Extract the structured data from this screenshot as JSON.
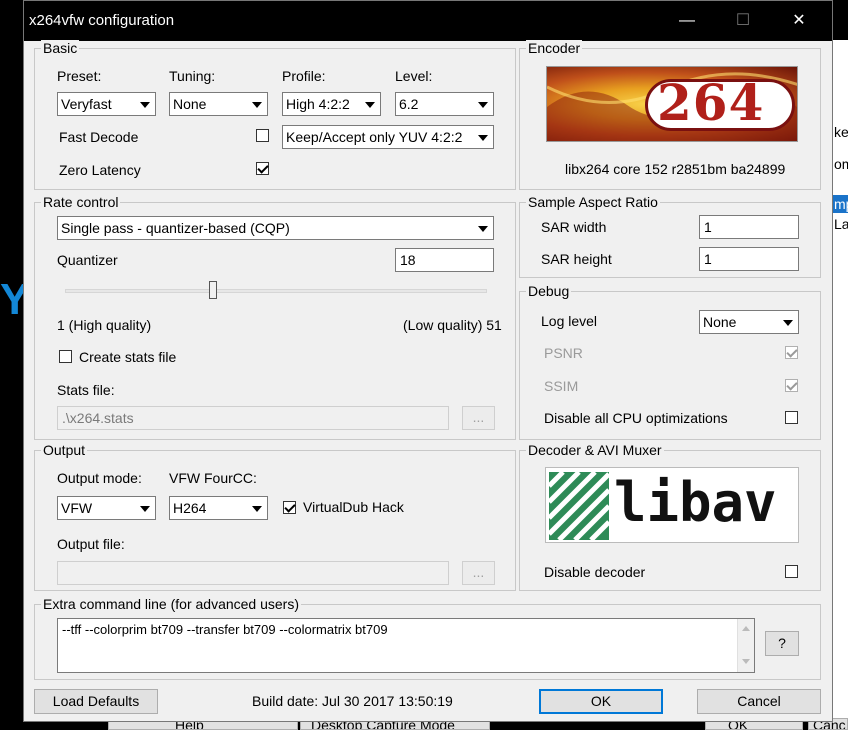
{
  "window": {
    "title": "x264vfw configuration",
    "controls": [
      "—",
      "☐",
      "✕"
    ]
  },
  "background_app": {
    "right_texts": [
      "key",
      "om",
      "mp",
      "La"
    ],
    "left_logo": "Y",
    "bottom_buttons": [
      "Help",
      "Desktop Capture Mode",
      "OK",
      "Canc"
    ]
  },
  "basic": {
    "title": "Basic",
    "preset_label": "Preset:",
    "preset_value": "Veryfast",
    "tuning_label": "Tuning:",
    "tuning_value": "None",
    "profile_label": "Profile:",
    "profile_value": "High 4:2:2",
    "level_label": "Level:",
    "level_value": "6.2",
    "fast_decode_label": "Fast Decode",
    "zero_latency_label": "Zero Latency",
    "colorspace_value": "Keep/Accept only YUV 4:2:2"
  },
  "encoder": {
    "title": "Encoder",
    "logo_text": "264",
    "version": "libx264 core 152 r2851bm ba24899"
  },
  "rate_control": {
    "title": "Rate control",
    "mode_value": "Single pass - quantizer-based (CQP)",
    "quantizer_label": "Quantizer",
    "quantizer_value": "18",
    "slider_fraction": 0.35,
    "high_label": "1 (High quality)",
    "low_label": "(Low quality) 51",
    "create_stats_label": "Create stats file",
    "stats_file_label": "Stats file:",
    "stats_file_value": ".\\x264.stats",
    "browse_label": "..."
  },
  "sar": {
    "title": "Sample Aspect Ratio",
    "width_label": "SAR width",
    "width_value": "1",
    "height_label": "SAR height",
    "height_value": "1"
  },
  "debug": {
    "title": "Debug",
    "log_level_label": "Log level",
    "log_level_value": "None",
    "psnr_label": "PSNR",
    "ssim_label": "SSIM",
    "disable_cpu_label": "Disable all CPU optimizations"
  },
  "output": {
    "title": "Output",
    "mode_label": "Output mode:",
    "mode_value": "VFW",
    "fourcc_label": "VFW FourCC:",
    "fourcc_value": "H264",
    "vdub_label": "VirtualDub Hack",
    "file_label": "Output file:",
    "browse_label": "..."
  },
  "decoder": {
    "title": "Decoder & AVI Muxer",
    "logo_text": "libav",
    "disable_label": "Disable decoder"
  },
  "extra": {
    "title": "Extra command line (for advanced users)",
    "value": "--tff --colorprim bt709 --transfer bt709 --colormatrix bt709",
    "help_label": "?"
  },
  "footer": {
    "load_defaults": "Load Defaults",
    "build_date": "Build date: Jul 30 2017 13:50:19",
    "ok": "OK",
    "cancel": "Cancel"
  },
  "colors": {
    "title_bar": "#000000",
    "dialog_bg": "#f0f0f0",
    "libav_green": "#2e8b57",
    "x264_red": "#b0201a",
    "default_button_border": "#0078d7"
  }
}
